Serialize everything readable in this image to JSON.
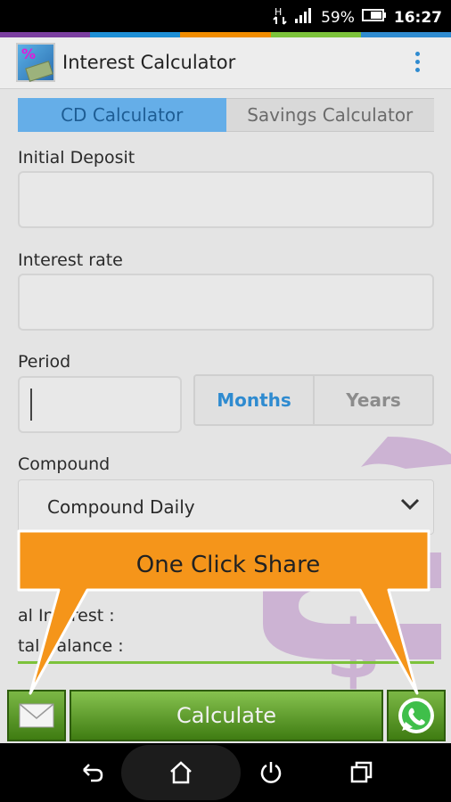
{
  "status_bar": {
    "network": "H",
    "battery": "59%",
    "time": "16:27",
    "icons": [
      "network-h-icon",
      "signal-icon",
      "battery-icon"
    ]
  },
  "stripe_colors": [
    "#7b3fa0",
    "#1e8fd6",
    "#f08c00",
    "#7cc23b",
    "#2f8bd0"
  ],
  "app_bar": {
    "title": "Interest Calculator",
    "logo_icon": "app-logo-icon",
    "menu_icon": "overflow-menu-icon"
  },
  "tabs": [
    {
      "label": "CD Calculator",
      "active": true
    },
    {
      "label": "Savings Calculator",
      "active": false
    }
  ],
  "form": {
    "initial_deposit_label": "Initial Deposit",
    "initial_deposit_value": "",
    "interest_rate_label": "Interest rate",
    "interest_rate_value": "",
    "period_label": "Period",
    "period_value": "",
    "period_units": [
      "Months",
      "Years"
    ],
    "period_unit_selected": "Months",
    "compound_label": "Compound",
    "compound_value": "Compound Daily"
  },
  "results": {
    "total_interest_label": "al Interest :",
    "total_balance_label": "tal Balance :"
  },
  "callout": {
    "text": "One Click Share",
    "color": "#f5951a"
  },
  "buttons": {
    "calculate_label": "Calculate",
    "email_icon": "email-icon",
    "whatsapp_icon": "whatsapp-icon"
  },
  "nav_bar": {
    "icons": [
      "back-icon",
      "home-icon",
      "power-icon",
      "recents-icon"
    ]
  },
  "colors": {
    "tab_active": "#65aee8",
    "accent_blue": "#2f8bd0",
    "button_green": "#4f8f1f",
    "result_line": "#7cc23b"
  }
}
